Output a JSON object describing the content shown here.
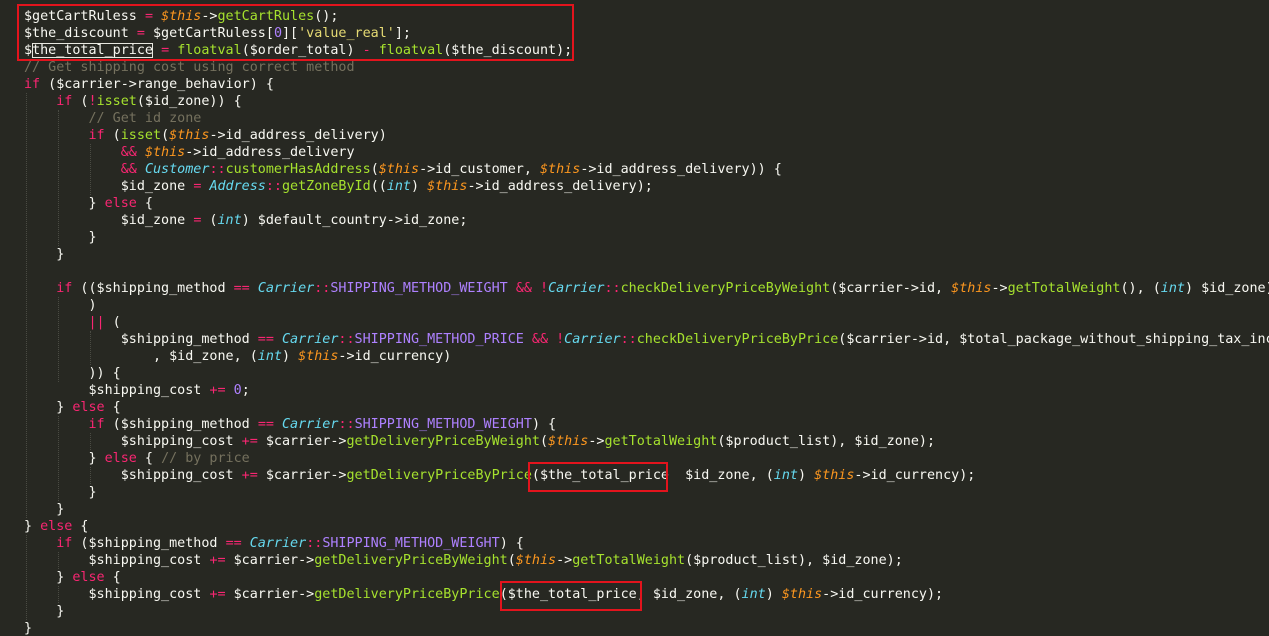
{
  "colors": {
    "background": "#272822",
    "text": "#F8F8F2",
    "keyword": "#F92672",
    "function": "#A6E22E",
    "this": "#FD971F",
    "class": "#66D9EF",
    "comment": "#75715E",
    "string": "#E6DB74",
    "number": "#AE81FF",
    "highlight_box": "#E3141D"
  },
  "code": {
    "lines": [
      [
        [
          "pl",
          "$getCartRuless "
        ],
        [
          "op",
          "="
        ],
        [
          "pl",
          " "
        ],
        [
          "th",
          "$this"
        ],
        [
          "pl",
          "->"
        ],
        [
          "fn",
          "getCartRules"
        ],
        [
          "pl",
          "();"
        ]
      ],
      [
        [
          "pl",
          "$the_discount "
        ],
        [
          "op",
          "="
        ],
        [
          "pl",
          " $getCartRuless["
        ],
        [
          "nm",
          "0"
        ],
        [
          "pl",
          "]["
        ],
        [
          "st",
          "'value_real'"
        ],
        [
          "pl",
          "];"
        ]
      ],
      [
        [
          "pl",
          "$"
        ],
        [
          "pl",
          "the_total_price"
        ],
        [
          "pl",
          " "
        ],
        [
          "op",
          "="
        ],
        [
          "pl",
          " "
        ],
        [
          "fn",
          "floatval"
        ],
        [
          "pl",
          "($order_total) "
        ],
        [
          "op",
          "-"
        ],
        [
          "pl",
          " "
        ],
        [
          "fn",
          "floatval"
        ],
        [
          "pl",
          "($the_discount);"
        ]
      ],
      [
        [
          "ct",
          "// Get shipping cost using correct method"
        ]
      ],
      [
        [
          "kw",
          "if"
        ],
        [
          "pl",
          " ($carrier->range_behavior) {"
        ]
      ],
      [
        [
          "pl",
          "    "
        ],
        [
          "kw",
          "if"
        ],
        [
          "pl",
          " ("
        ],
        [
          "op",
          "!"
        ],
        [
          "fn",
          "isset"
        ],
        [
          "pl",
          "($id_zone)) {"
        ]
      ],
      [
        [
          "pl",
          "        "
        ],
        [
          "ct",
          "// Get id zone"
        ]
      ],
      [
        [
          "pl",
          "        "
        ],
        [
          "kw",
          "if"
        ],
        [
          "pl",
          " ("
        ],
        [
          "fn",
          "isset"
        ],
        [
          "pl",
          "("
        ],
        [
          "th",
          "$this"
        ],
        [
          "pl",
          "->id_address_delivery)"
        ]
      ],
      [
        [
          "pl",
          "            "
        ],
        [
          "op",
          "&&"
        ],
        [
          "pl",
          " "
        ],
        [
          "th",
          "$this"
        ],
        [
          "pl",
          "->id_address_delivery"
        ]
      ],
      [
        [
          "pl",
          "            "
        ],
        [
          "op",
          "&&"
        ],
        [
          "pl",
          " "
        ],
        [
          "cl",
          "Customer"
        ],
        [
          "op",
          "::"
        ],
        [
          "fn",
          "customerHasAddress"
        ],
        [
          "pl",
          "("
        ],
        [
          "th",
          "$this"
        ],
        [
          "pl",
          "->id_customer, "
        ],
        [
          "th",
          "$this"
        ],
        [
          "pl",
          "->id_address_delivery)) {"
        ]
      ],
      [
        [
          "pl",
          "            $id_zone "
        ],
        [
          "op",
          "="
        ],
        [
          "pl",
          " "
        ],
        [
          "cl",
          "Address"
        ],
        [
          "op",
          "::"
        ],
        [
          "fn",
          "getZoneById"
        ],
        [
          "pl",
          "(("
        ],
        [
          "ty",
          "int"
        ],
        [
          "pl",
          ") "
        ],
        [
          "th",
          "$this"
        ],
        [
          "pl",
          "->id_address_delivery);"
        ]
      ],
      [
        [
          "pl",
          "        } "
        ],
        [
          "kw",
          "else"
        ],
        [
          "pl",
          " {"
        ]
      ],
      [
        [
          "pl",
          "            $id_zone "
        ],
        [
          "op",
          "="
        ],
        [
          "pl",
          " ("
        ],
        [
          "ty",
          "int"
        ],
        [
          "pl",
          ") $default_country->id_zone;"
        ]
      ],
      [
        [
          "pl",
          "        }"
        ]
      ],
      [
        [
          "pl",
          "    }"
        ]
      ],
      [
        [
          "pl",
          ""
        ]
      ],
      [
        [
          "pl",
          "    "
        ],
        [
          "kw",
          "if"
        ],
        [
          "pl",
          " (($shipping_method "
        ],
        [
          "op",
          "=="
        ],
        [
          "pl",
          " "
        ],
        [
          "cl",
          "Carrier"
        ],
        [
          "op",
          "::"
        ],
        [
          "cn",
          "SHIPPING_METHOD_WEIGHT"
        ],
        [
          "pl",
          " "
        ],
        [
          "op",
          "&&"
        ],
        [
          "pl",
          " "
        ],
        [
          "op",
          "!"
        ],
        [
          "cl",
          "Carrier"
        ],
        [
          "op",
          "::"
        ],
        [
          "fn",
          "checkDeliveryPriceByWeight"
        ],
        [
          "pl",
          "($carrier->id, "
        ],
        [
          "th",
          "$this"
        ],
        [
          "pl",
          "->"
        ],
        [
          "fn",
          "getTotalWeight"
        ],
        [
          "pl",
          "(), ("
        ],
        [
          "ty",
          "int"
        ],
        [
          "pl",
          ") $id_zone)"
        ]
      ],
      [
        [
          "pl",
          "        )"
        ]
      ],
      [
        [
          "pl",
          "        "
        ],
        [
          "op",
          "||"
        ],
        [
          "pl",
          " ("
        ]
      ],
      [
        [
          "pl",
          "            $shipping_method "
        ],
        [
          "op",
          "=="
        ],
        [
          "pl",
          " "
        ],
        [
          "cl",
          "Carrier"
        ],
        [
          "op",
          "::"
        ],
        [
          "cn",
          "SHIPPING_METHOD_PRICE"
        ],
        [
          "pl",
          " "
        ],
        [
          "op",
          "&&"
        ],
        [
          "pl",
          " "
        ],
        [
          "op",
          "!"
        ],
        [
          "cl",
          "Carrier"
        ],
        [
          "op",
          "::"
        ],
        [
          "fn",
          "checkDeliveryPriceByPrice"
        ],
        [
          "pl",
          "($carrier->id, $total_package_without_shipping_tax_inc"
        ]
      ],
      [
        [
          "pl",
          "                , $id_zone, ("
        ],
        [
          "ty",
          "int"
        ],
        [
          "pl",
          ") "
        ],
        [
          "th",
          "$this"
        ],
        [
          "pl",
          "->id_currency)"
        ]
      ],
      [
        [
          "pl",
          "        )) {"
        ]
      ],
      [
        [
          "pl",
          "        $shipping_cost "
        ],
        [
          "op",
          "+="
        ],
        [
          "pl",
          " "
        ],
        [
          "nm",
          "0"
        ],
        [
          "pl",
          ";"
        ]
      ],
      [
        [
          "pl",
          "    } "
        ],
        [
          "kw",
          "else"
        ],
        [
          "pl",
          " {"
        ]
      ],
      [
        [
          "pl",
          "        "
        ],
        [
          "kw",
          "if"
        ],
        [
          "pl",
          " ($shipping_method "
        ],
        [
          "op",
          "=="
        ],
        [
          "pl",
          " "
        ],
        [
          "cl",
          "Carrier"
        ],
        [
          "op",
          "::"
        ],
        [
          "cn",
          "SHIPPING_METHOD_WEIGHT"
        ],
        [
          "pl",
          ") {"
        ]
      ],
      [
        [
          "pl",
          "            $shipping_cost "
        ],
        [
          "op",
          "+="
        ],
        [
          "pl",
          " $carrier->"
        ],
        [
          "fn",
          "getDeliveryPriceByWeight"
        ],
        [
          "pl",
          "("
        ],
        [
          "th",
          "$this"
        ],
        [
          "pl",
          "->"
        ],
        [
          "fn",
          "getTotalWeight"
        ],
        [
          "pl",
          "($product_list), $id_zone);"
        ]
      ],
      [
        [
          "pl",
          "        } "
        ],
        [
          "kw",
          "else"
        ],
        [
          "pl",
          " { "
        ],
        [
          "ct",
          "// by price"
        ]
      ],
      [
        [
          "pl",
          "            $shipping_cost "
        ],
        [
          "op",
          "+="
        ],
        [
          "pl",
          " $carrier->"
        ],
        [
          "fn",
          "getDeliveryPriceByPrice"
        ],
        [
          "pl",
          "($the_total_price  $id_zone, ("
        ],
        [
          "ty",
          "int"
        ],
        [
          "pl",
          ") "
        ],
        [
          "th",
          "$this"
        ],
        [
          "pl",
          "->id_currency);"
        ]
      ],
      [
        [
          "pl",
          "        }"
        ]
      ],
      [
        [
          "pl",
          "    }"
        ]
      ],
      [
        [
          "pl",
          "} "
        ],
        [
          "kw",
          "else"
        ],
        [
          "pl",
          " {"
        ]
      ],
      [
        [
          "pl",
          "    "
        ],
        [
          "kw",
          "if"
        ],
        [
          "pl",
          " ($shipping_method "
        ],
        [
          "op",
          "=="
        ],
        [
          "pl",
          " "
        ],
        [
          "cl",
          "Carrier"
        ],
        [
          "op",
          "::"
        ],
        [
          "cn",
          "SHIPPING_METHOD_WEIGHT"
        ],
        [
          "pl",
          ") {"
        ]
      ],
      [
        [
          "pl",
          "        $shipping_cost "
        ],
        [
          "op",
          "+="
        ],
        [
          "pl",
          " $carrier->"
        ],
        [
          "fn",
          "getDeliveryPriceByWeight"
        ],
        [
          "pl",
          "("
        ],
        [
          "th",
          "$this"
        ],
        [
          "pl",
          "->"
        ],
        [
          "fn",
          "getTotalWeight"
        ],
        [
          "pl",
          "($product_list), $id_zone);"
        ]
      ],
      [
        [
          "pl",
          "    } "
        ],
        [
          "kw",
          "else"
        ],
        [
          "pl",
          " {"
        ]
      ],
      [
        [
          "pl",
          "        $shipping_cost "
        ],
        [
          "op",
          "+="
        ],
        [
          "pl",
          " $carrier->"
        ],
        [
          "fn",
          "getDeliveryPriceByPrice"
        ],
        [
          "pl",
          "($the_total_price, $id_zone, ("
        ],
        [
          "ty",
          "int"
        ],
        [
          "pl",
          ") "
        ],
        [
          "th",
          "$this"
        ],
        [
          "pl",
          "->id_currency);"
        ]
      ],
      [
        [
          "pl",
          "    }"
        ]
      ],
      [
        [
          "pl",
          "}"
        ]
      ]
    ]
  }
}
